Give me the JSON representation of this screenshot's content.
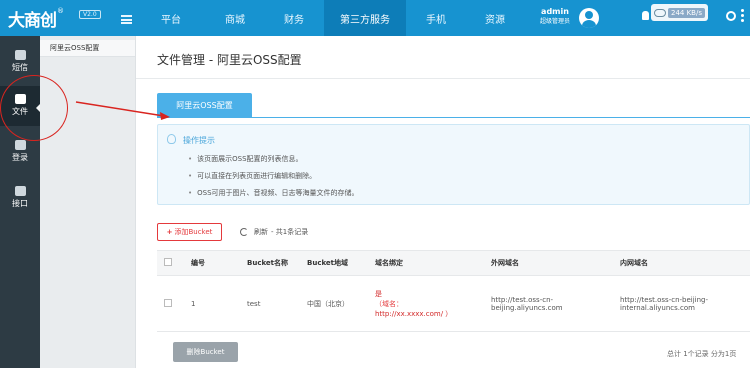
{
  "topbar": {
    "logo_text": "大商创",
    "logo_reg": "®",
    "version": "V2.0",
    "nav": [
      "平台",
      "商城",
      "财务",
      "第三方服务",
      "手机",
      "资源"
    ],
    "active_nav": "第三方服务",
    "user_name": "admin",
    "user_role": "超级管理员",
    "net_speed": "244 KB/s"
  },
  "leftbar": {
    "items": [
      {
        "label": "短信",
        "icon": "sms-icon"
      },
      {
        "label": "文件",
        "icon": "folder-icon"
      },
      {
        "label": "登录",
        "icon": "users-icon"
      },
      {
        "label": "接口",
        "icon": "api-icon"
      }
    ]
  },
  "subbar": {
    "items": [
      "阿里云OSS配置"
    ]
  },
  "content": {
    "title": "文件管理 - 阿里云OSS配置",
    "tab_label": "阿里云OSS配置",
    "tips_title": "操作提示",
    "tips": [
      "该页面展示OSS配置的列表信息。",
      "可以直接在列表页面进行编辑和删除。",
      "OSS可用于图片、音视频、日志等海量文件的存储。"
    ],
    "add_button": "添加Bucket",
    "refresh_label": "刷新",
    "record_count": "- 共1条记录",
    "columns": [
      "编号",
      "Bucket名称",
      "Bucket地域",
      "域名绑定",
      "外网域名",
      "内网域名"
    ],
    "rows": [
      {
        "id": "1",
        "name": "test",
        "region": "中国（北京）",
        "domain_main": "是",
        "domain_note": "（域名：",
        "domain_link": "http://xx.xxxx.com/ ）",
        "public_domain": "http://test.oss-cn-beijing.aliyuncs.com",
        "internal_domain": "http://test.oss-cn-beijing-internal.aliyuncs.com"
      }
    ],
    "delete_button": "删除Bucket",
    "footer_info": "总计 1个记录 分为1页"
  }
}
